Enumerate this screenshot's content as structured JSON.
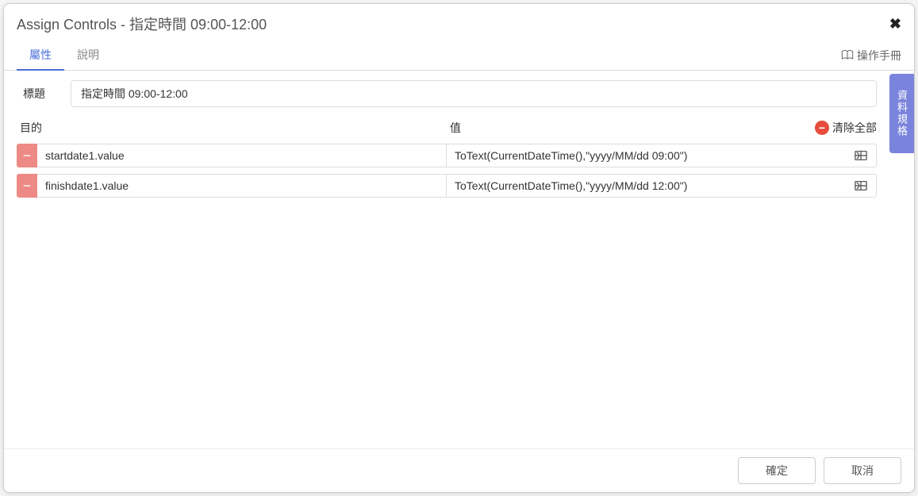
{
  "dialog": {
    "title": "Assign Controls - 指定時間 09:00-12:00"
  },
  "tabs": {
    "properties": "屬性",
    "description": "說明",
    "manual": "操作手冊"
  },
  "side_tab": "資料規格",
  "form": {
    "title_label": "標題",
    "title_value": "指定時間 09:00-12:00"
  },
  "columns": {
    "target": "目的",
    "value": "值",
    "clear_all": "清除全部"
  },
  "rows": [
    {
      "target": "startdate1.value",
      "value": "ToText(CurrentDateTime(),\"yyyy/MM/dd 09:00\")"
    },
    {
      "target": "finishdate1.value",
      "value": "ToText(CurrentDateTime(),\"yyyy/MM/dd 12:00\")"
    }
  ],
  "buttons": {
    "ok": "確定",
    "cancel": "取消"
  }
}
